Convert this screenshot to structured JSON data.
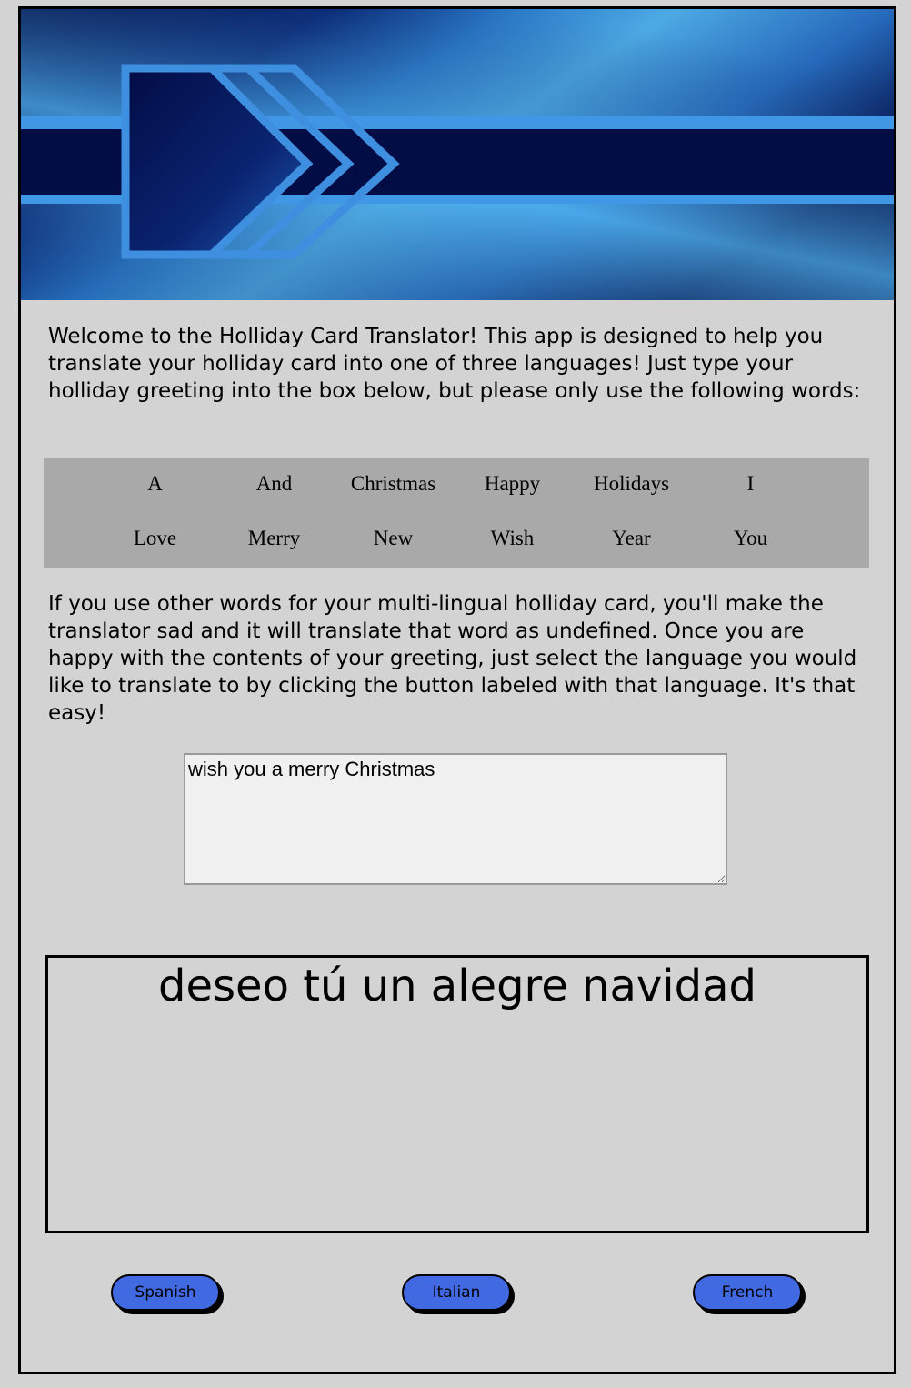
{
  "intro_text": "Welcome to the Holliday Card Translator! This app is designed to help you translate your holliday card into one of three languages! Just type your holliday greeting into the box below, but please only use the following words:",
  "allowed_words": {
    "row1": [
      "A",
      "And",
      "Christmas",
      "Happy",
      "Holidays",
      "I"
    ],
    "row2": [
      "Love",
      "Merry",
      "New",
      "Wish",
      "Year",
      "You"
    ]
  },
  "instructions_text": "If you use other words for your multi-lingual holliday card, you'll make the translator sad and it will translate that word as undefined. Once you are happy with the contents of your greeting, just select the language you would like to translate to by clicking the button labeled with that language. It's that easy!",
  "greeting_input": {
    "value": "wish you a merry Christmas"
  },
  "translation_output": "deseo tú un alegre navidad",
  "buttons": {
    "spanish": "Spanish",
    "italian": "Italian",
    "french": "French"
  },
  "colors": {
    "page_background": "#d3d3d3",
    "word_table_background": "#a9a9a9",
    "button_fill": "#4169e1",
    "banner_dark": "#020c45",
    "banner_light": "#55bbf5"
  }
}
